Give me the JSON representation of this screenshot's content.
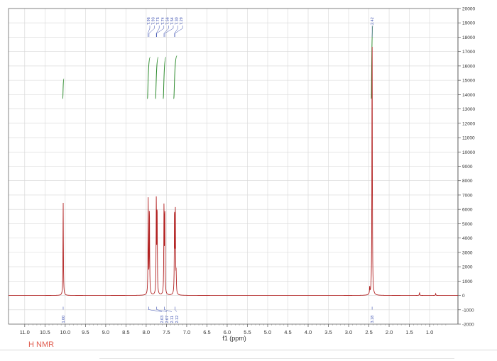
{
  "caption": "H NMR",
  "chart_data": {
    "type": "line",
    "xlabel": "f1 (ppm)",
    "x_reversed": true,
    "xlim": [
      11.4,
      0.3
    ],
    "ylim": [
      -2000,
      20000
    ],
    "grid": true,
    "x_ticks": [
      11.0,
      10.5,
      10.0,
      9.5,
      9.0,
      8.5,
      8.0,
      7.5,
      7.0,
      6.5,
      6.0,
      5.5,
      5.0,
      4.5,
      4.0,
      3.5,
      3.0,
      2.5,
      2.0,
      1.5,
      1.0
    ],
    "y_ticks": [
      -2000,
      -1000,
      0,
      1000,
      2000,
      3000,
      4000,
      5000,
      6000,
      7000,
      8000,
      9000,
      10000,
      11000,
      12000,
      13000,
      14000,
      15000,
      16000,
      17000,
      18000,
      19000,
      20000
    ],
    "series": [
      {
        "color": "#b22222",
        "peaks": [
          {
            "shift": 10.05,
            "height": 6500
          },
          {
            "shift": 7.95,
            "height": 6600
          },
          {
            "shift": 7.92,
            "height": 6200
          },
          {
            "shift": 7.75,
            "height": 6550
          },
          {
            "shift": 7.73,
            "height": 6100
          },
          {
            "shift": 7.56,
            "height": 6200
          },
          {
            "shift": 7.54,
            "height": 5950
          },
          {
            "shift": 7.3,
            "height": 6000
          },
          {
            "shift": 7.28,
            "height": 5700
          },
          {
            "shift": 7.26,
            "height": 1300
          },
          {
            "shift": 2.42,
            "height": 18800
          },
          {
            "shift": 2.48,
            "height": 500
          },
          {
            "shift": 1.25,
            "height": 200
          },
          {
            "shift": 0.85,
            "height": 120
          }
        ]
      }
    ],
    "peak_labels": [
      "7.96",
      "7.93",
      "7.75",
      "7.74",
      "7.56",
      "7.54",
      "7.30",
      "7.29",
      "2.42"
    ],
    "integration_curves": [
      {
        "start": 10.06,
        "end": 10.03,
        "low": 13700,
        "high": 15100
      },
      {
        "start": 7.97,
        "end": 7.9,
        "low": 13700,
        "high": 16600
      },
      {
        "start": 7.77,
        "end": 7.7,
        "low": 13700,
        "high": 16600
      },
      {
        "start": 7.58,
        "end": 7.51,
        "low": 13700,
        "high": 16600
      },
      {
        "start": 7.32,
        "end": 7.24,
        "low": 13700,
        "high": 16700
      },
      {
        "start": 2.44,
        "end": 2.4,
        "low": 13700,
        "high": 18800
      }
    ],
    "integrals": [
      {
        "shift": 10.05,
        "value": "1.00"
      },
      {
        "shift": 7.94,
        "value": "2.03"
      },
      {
        "shift": 7.74,
        "value": "2.07"
      },
      {
        "shift": 7.55,
        "value": "2.11"
      },
      {
        "shift": 7.29,
        "value": "2.12"
      },
      {
        "shift": 2.42,
        "value": "3.18"
      }
    ]
  }
}
